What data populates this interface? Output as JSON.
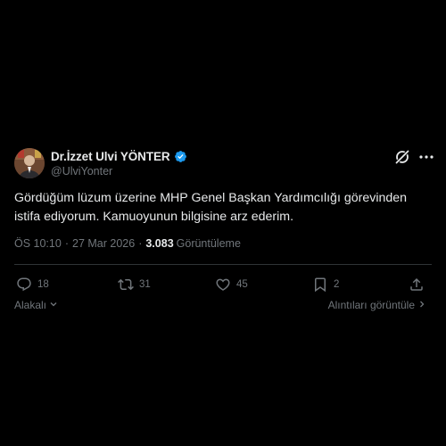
{
  "author": {
    "display_name": "Dr.İzzet Ulvi YÖNTER",
    "handle": "@UlviYonter",
    "verified_badge_color": "#1d9bf0"
  },
  "tweet": {
    "text": "Gördüğüm lüzum üzerine MHP Genel Başkan Yardımcılığı görevinden\nistifa ediyorum. Kamuoyunun bilgisine arz ederim.",
    "time": "ÖS 10:10",
    "separator": "·",
    "date": "27 Mar 2026",
    "views_count": "3.083",
    "views_label": "Görüntüleme"
  },
  "actions": {
    "replies": "18",
    "retweets": "31",
    "likes": "45",
    "bookmarks": "2"
  },
  "footer": {
    "relevant_label": "Alakalı",
    "quotes_label": "Alıntıları görüntüle"
  },
  "icons": {
    "header": [
      "grok-icon",
      "more-icon"
    ],
    "actions": [
      "reply-icon",
      "retweet-icon",
      "like-icon",
      "bookmark-icon",
      "share-icon"
    ]
  },
  "colors": {
    "background": "#000000",
    "primary_text": "#e7e9ea",
    "secondary_text": "#71767b",
    "divider": "#2f3336",
    "accent": "#1d9bf0"
  }
}
